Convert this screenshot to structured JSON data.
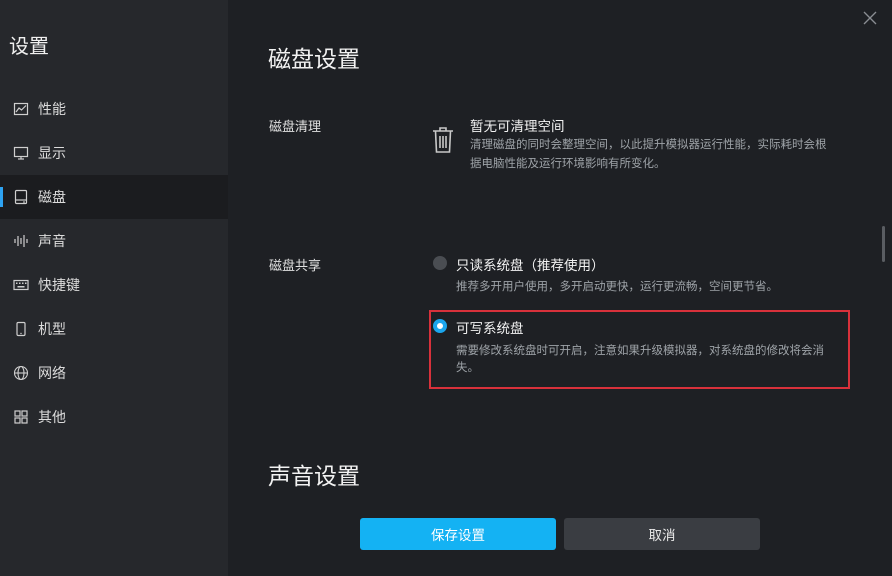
{
  "sidebar": {
    "title": "设置",
    "items": [
      {
        "label": "性能",
        "icon": "performance-chart-icon"
      },
      {
        "label": "显示",
        "icon": "monitor-icon"
      },
      {
        "label": "磁盘",
        "icon": "disk-icon",
        "active": true
      },
      {
        "label": "声音",
        "icon": "sound-wave-icon"
      },
      {
        "label": "快捷键",
        "icon": "keyboard-icon"
      },
      {
        "label": "机型",
        "icon": "phone-icon"
      },
      {
        "label": "网络",
        "icon": "globe-icon"
      },
      {
        "label": "其他",
        "icon": "grid-icon"
      }
    ]
  },
  "disk_section": {
    "title": "磁盘设置",
    "cleanup": {
      "label": "磁盘清理",
      "title": "暂无可清理空间",
      "desc_line1": "清理磁盘的同时会整理空间，以此提升模拟器运行性能，实际耗时会根",
      "desc_line2": "据电脑性能及运行环境影响有所变化。"
    },
    "share": {
      "label": "磁盘共享",
      "options": [
        {
          "title": "只读系统盘（推荐使用）",
          "desc_line1": "推荐多开用户使用，多开启动更快，运行更流畅，空间更节省。",
          "desc_line2": "",
          "selected": false
        },
        {
          "title": "可写系统盘",
          "desc_line1": "需要修改系统盘时可开启，注意如果升级模拟器，对系统盘的修改将会消",
          "desc_line2": "失。",
          "selected": true
        }
      ]
    }
  },
  "sound_section": {
    "title": "声音设置"
  },
  "footer": {
    "save_label": "保存设置",
    "cancel_label": "取消"
  },
  "colors": {
    "accent": "#14b2f3",
    "highlight": "#d8313b",
    "sidebar_bg": "#26282c",
    "main_bg": "#1e2024"
  }
}
